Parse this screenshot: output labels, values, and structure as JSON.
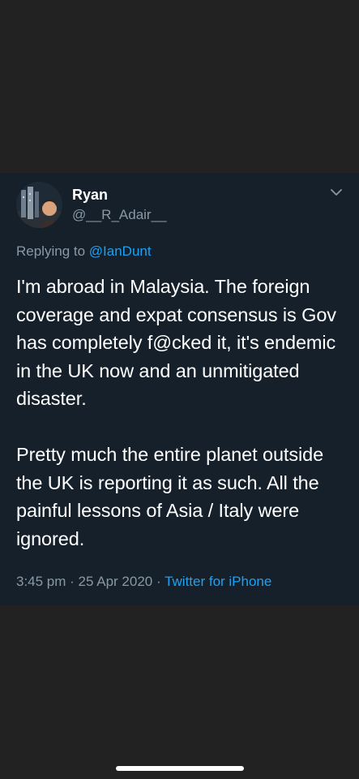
{
  "tweet": {
    "display_name": "Ryan",
    "handle": "@__R_Adair__",
    "reply_prefix": "Replying to ",
    "reply_mention": "@IanDunt",
    "paragraph_1": "I'm abroad in Malaysia. The foreign coverage and expat consensus is Gov has completely f@cked it, it's endemic in the UK now and an unmitigated disaster.",
    "paragraph_2": "Pretty much the entire planet outside the UK is reporting it as such. All the painful lessons of Asia / Italy were ignored.",
    "time": "3:45 pm",
    "separator": " · ",
    "date": "25 Apr 2020",
    "source": "Twitter for iPhone"
  },
  "icons": {
    "menu": "chevron-down-icon",
    "avatar": "avatar"
  },
  "colors": {
    "background": "#222222",
    "card": "#15202b",
    "text": "#ffffff",
    "secondary": "#8899a6",
    "link": "#1da1f2"
  }
}
